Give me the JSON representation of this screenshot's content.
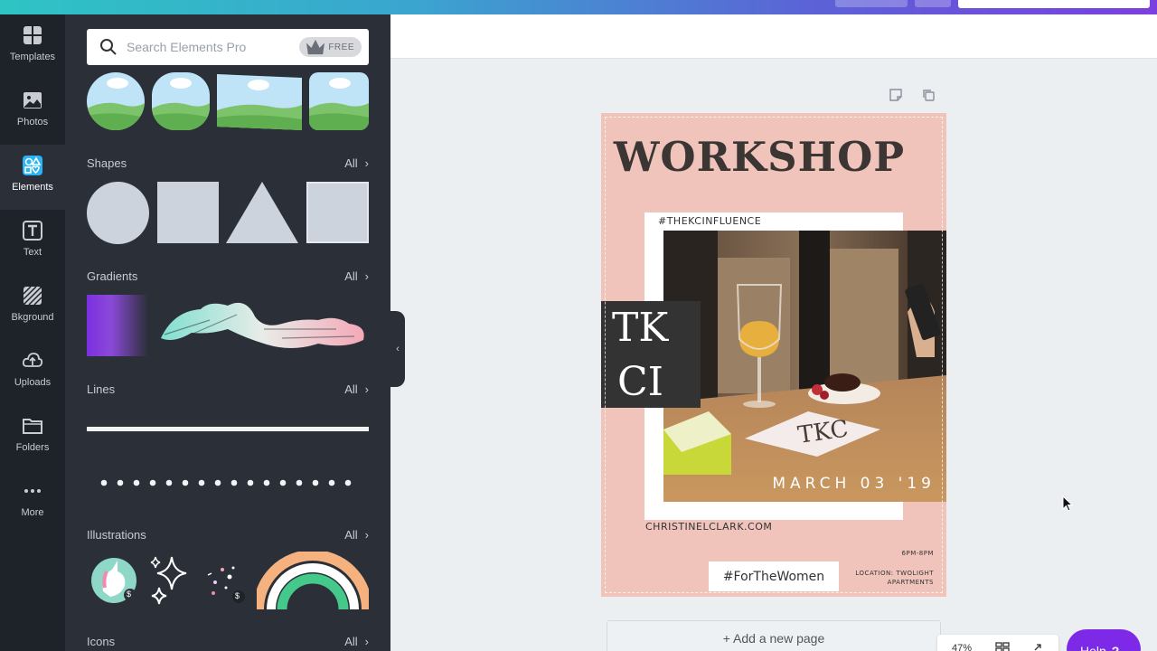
{
  "sidebar": {
    "items": [
      {
        "label": "Templates",
        "icon": "templates-icon"
      },
      {
        "label": "Photos",
        "icon": "photos-icon"
      },
      {
        "label": "Elements",
        "icon": "elements-icon",
        "active": true
      },
      {
        "label": "Text",
        "icon": "text-icon"
      },
      {
        "label": "Bkground",
        "icon": "background-icon"
      },
      {
        "label": "Uploads",
        "icon": "uploads-icon"
      },
      {
        "label": "Folders",
        "icon": "folders-icon"
      },
      {
        "label": "More",
        "icon": "more-icon"
      }
    ]
  },
  "panel": {
    "search_placeholder": "Search Elements Pro",
    "free_badge": "FREE",
    "all_label": "All",
    "sections": {
      "shapes": "Shapes",
      "gradients": "Gradients",
      "lines": "Lines",
      "illustrations": "Illustrations",
      "icons": "Icons"
    },
    "price_badge": "$"
  },
  "design": {
    "title": "WORKSHOP",
    "hashtag_top": "#THEKCINFLUENCE",
    "date": "MARCH 03 '19",
    "overlay_line1": "TK",
    "overlay_line2": "CI",
    "website": "CHRISTINELCLARK.COM",
    "time": "6PM-8PM",
    "location_line1": "LOCATION: TWOLIGHT",
    "location_line2": "APARTMENTS",
    "hashtag_bottom": "#ForTheWomen"
  },
  "canvas": {
    "add_page": "+ Add a new page",
    "zoom": "47%",
    "help": "Help",
    "help_mark": "?"
  },
  "colors": {
    "accent": "#7d2ae8",
    "active_icon": "#2ab4f5",
    "page_background": "#f0c3bb",
    "sidebar": "#1e2229",
    "panel": "#2b2f38"
  }
}
